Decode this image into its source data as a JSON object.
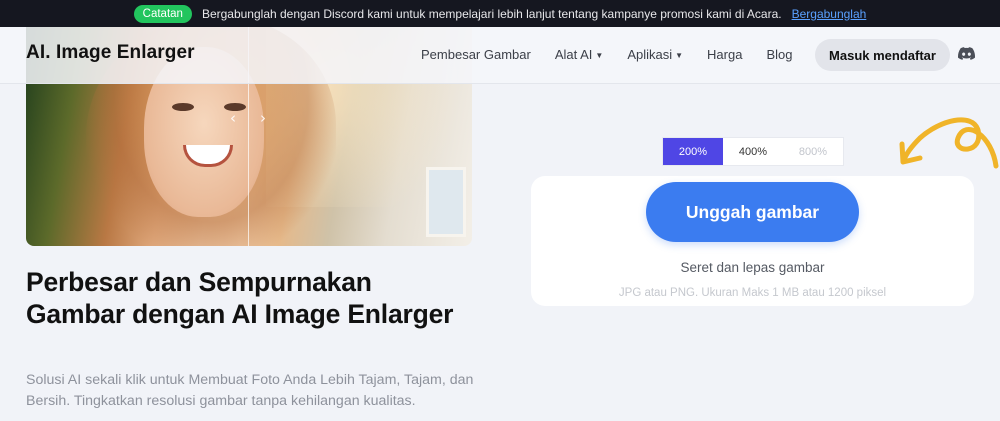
{
  "notice": {
    "badge": "Catatan",
    "text": "Bergabunglah dengan Discord kami untuk mempelajari lebih lanjut tentang kampanye promosi kami di Acara.",
    "link": "Bergabunglah"
  },
  "header": {
    "logo": "AI. Image Enlarger",
    "nav": [
      "Pembesar Gambar",
      "Alat AI",
      "Aplikasi",
      "Harga",
      "Blog"
    ],
    "login": "Masuk mendaftar",
    "discord_icon": "discord-icon"
  },
  "hero": {
    "headline": "Perbesar dan Sempurnakan Gambar dengan AI Image Enlarger",
    "subtext": "Solusi AI sekali klik untuk Membuat Foto Anda Lebih Tajam, Tajam, dan Bersih. Tingkatkan resolusi gambar tanpa kehilangan kualitas."
  },
  "scales": {
    "options": [
      "200%",
      "400%",
      "800%"
    ],
    "selected": "200%"
  },
  "upload": {
    "button": "Unggah gambar",
    "drop": "Seret dan lepas gambar",
    "formats": "JPG atau PNG. Ukuran Maks 1 MB atau 1200 piksel"
  },
  "colors": {
    "accent": "#4f46e5",
    "upload_button": "#3b7cf0",
    "badge": "#22c55e",
    "doodle": "#f0b429"
  }
}
